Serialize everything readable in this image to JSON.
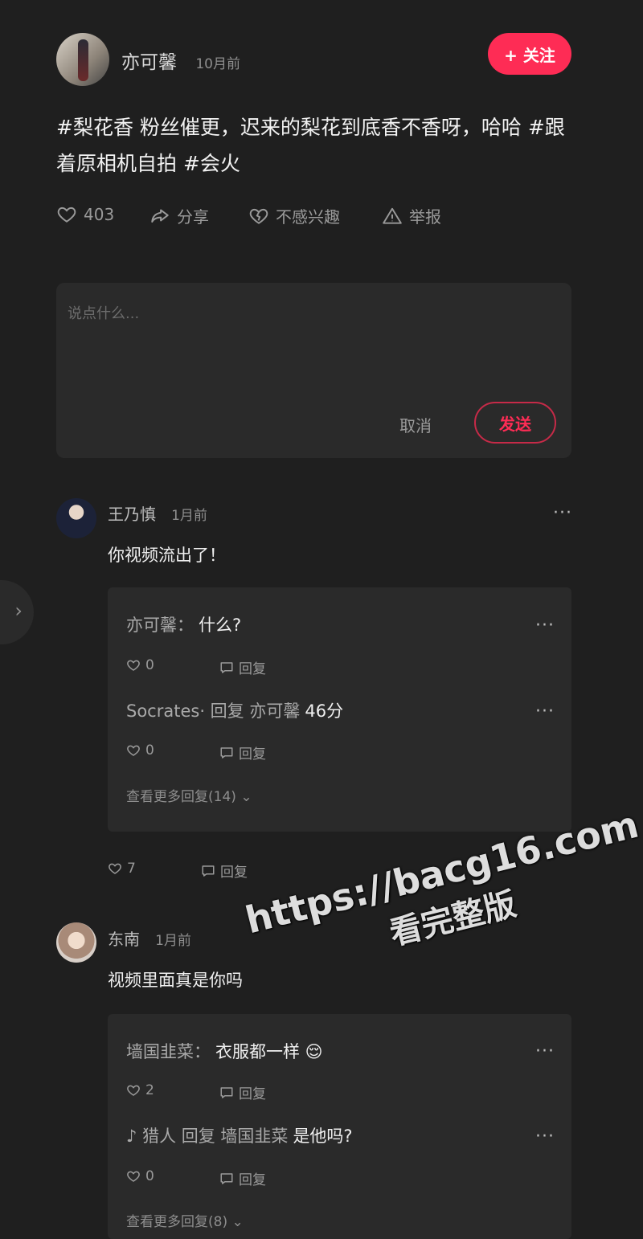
{
  "post": {
    "author": "亦可馨",
    "time": "10月前",
    "follow_label": "+ 关注",
    "text": "#梨花香 粉丝催更，迟来的梨花到底香不香呀，哈哈 #跟着原相机自拍 #会火",
    "actions": {
      "like_count": "403",
      "share_label": "分享",
      "not_interested_label": "不感兴趣",
      "report_label": "举报"
    }
  },
  "composer": {
    "placeholder": "说点什么...",
    "cancel_label": "取消",
    "send_label": "发送"
  },
  "comments": [
    {
      "author": "王乃慎",
      "time": "1月前",
      "text": "你视频流出了！",
      "likes": "7",
      "reply_label": "回复",
      "replies": [
        {
          "prefix": "亦可馨：",
          "text": "什么?",
          "likes": "0",
          "reply_label": "回复"
        },
        {
          "prefix": "Socrates· 回复 亦可馨",
          "text": "46分",
          "likes": "0",
          "reply_label": "回复"
        }
      ],
      "more_replies": "查看更多回复(14)"
    },
    {
      "author": "东南",
      "time": "1月前",
      "text": "视频里面真是你吗",
      "replies": [
        {
          "prefix": "墙国韭菜：",
          "text": "衣服都一样 😌",
          "likes": "2",
          "reply_label": "回复"
        },
        {
          "prefix": "♪ 猎人 回复 墙国韭菜",
          "text": "是他吗?",
          "likes": "0",
          "reply_label": "回复"
        }
      ],
      "more_replies": "查看更多回复(8)"
    }
  ],
  "watermark": {
    "line1": "https://bacg16.com",
    "line2": "看完整版"
  },
  "colors": {
    "background": "#1f1f1f",
    "panel": "#2a2a2a",
    "accent": "#fe2c55"
  }
}
